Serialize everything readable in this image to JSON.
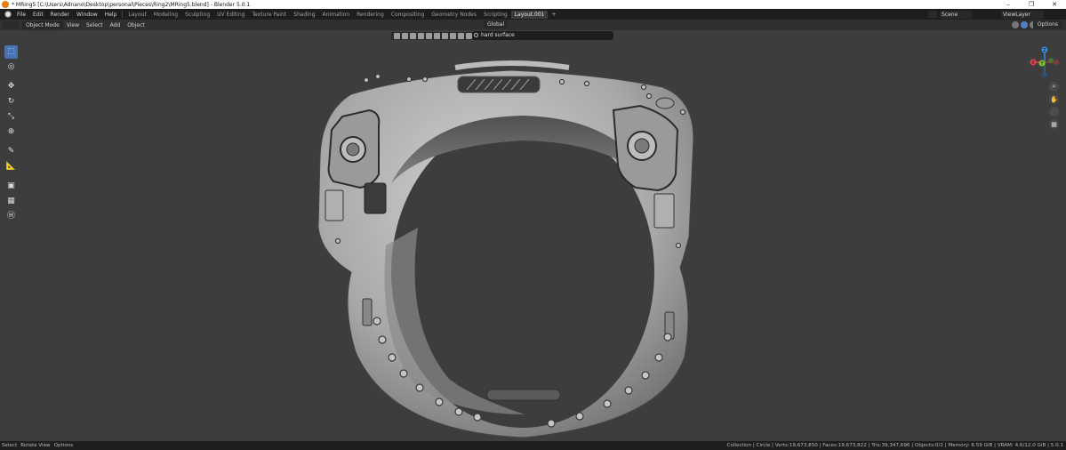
{
  "window": {
    "title": "* MRing5 [C:\\Users\\Adnano\\Desktop\\personal\\Pieces\\Ring2\\MRing5.blend] - Blender 5.0.1",
    "controls": [
      "–",
      "❐",
      "✕"
    ]
  },
  "menus": [
    "File",
    "Edit",
    "Render",
    "Window",
    "Help"
  ],
  "workspaces": [
    "Layout",
    "Modeling",
    "Sculpting",
    "UV Editing",
    "Texture Paint",
    "Shading",
    "Animation",
    "Rendering",
    "Compositing",
    "Geometry Nodes",
    "Scripting",
    "Layout.001"
  ],
  "active_workspace": "Layout.001",
  "add_workspace": "+",
  "scene": "Scene",
  "view_layer": "ViewLayer",
  "viewport_header": {
    "mode": "Object Mode",
    "menu": [
      "View",
      "Select",
      "Add",
      "Object"
    ],
    "orientation": "Global",
    "options": "Options"
  },
  "outliner_search": {
    "value": "hard surface"
  },
  "toolbar": [
    {
      "name": "select-box-tool",
      "glyph": "⬚",
      "active": true
    },
    {
      "name": "cursor-tool",
      "glyph": "◎",
      "active": false
    },
    {
      "name": "move-tool",
      "glyph": "✥",
      "active": false
    },
    {
      "name": "rotate-tool",
      "glyph": "↻",
      "active": false
    },
    {
      "name": "scale-tool",
      "glyph": "⤡",
      "active": false
    },
    {
      "name": "transform-tool",
      "glyph": "⊕",
      "active": false
    },
    {
      "name": "annotate-tool",
      "glyph": "✎",
      "active": false
    },
    {
      "name": "measure-tool",
      "glyph": "📐",
      "active": false
    },
    {
      "name": "add-cube-tool",
      "glyph": "▣",
      "active": false
    },
    {
      "name": "add-mesh-tool",
      "glyph": "▦",
      "active": false
    },
    {
      "name": "addon-tool",
      "glyph": "Ⓗ",
      "active": false
    }
  ],
  "gizmo": {
    "x": "X",
    "y": "Y",
    "z": "Z"
  },
  "nav_icons": [
    "⌕",
    "✋",
    "🎥",
    "▦"
  ],
  "status": {
    "left": [
      "Select",
      "Rotate View",
      "Options"
    ],
    "right": "Collection | Circle | Verts:19,673,850 | Faces:19,673,822 | Tris:39,347,696 | Objects:0/2 | Memory: 6.59 GiB | VRAM: 4.6/12.0 GiB | 5.0.1"
  },
  "colors": {
    "active": "#4772b3",
    "x_axis": "#e0454b",
    "y_axis": "#7ec32d",
    "z_axis": "#3d8be0",
    "viewport": "#3d3d3d"
  }
}
